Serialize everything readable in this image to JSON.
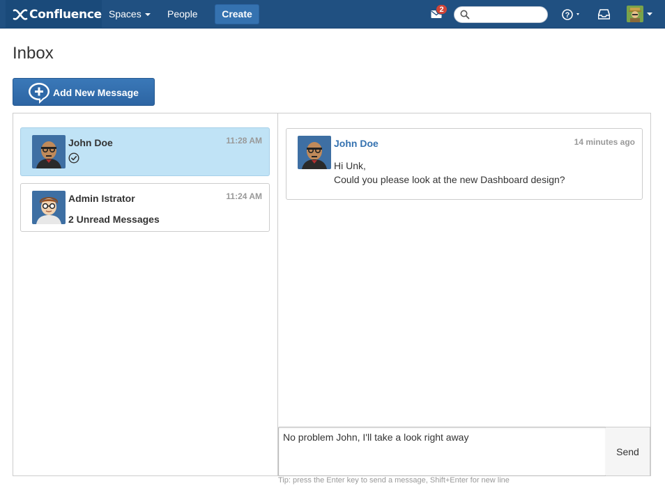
{
  "header": {
    "logo_text": "Confluence",
    "nav": {
      "spaces": "Spaces",
      "people": "People",
      "create": "Create"
    },
    "mail_badge": "2",
    "search_placeholder": ""
  },
  "page": {
    "title": "Inbox",
    "add_button": "Add New Message"
  },
  "conversations": [
    {
      "name": "John Doe",
      "time": "11:28 AM",
      "status": "read",
      "active": true
    },
    {
      "name": "Admin Istrator",
      "time": "11:24 AM",
      "unread": "2 Unread Messages",
      "active": false
    }
  ],
  "thread": {
    "author": "John Doe",
    "time": "14 minutes ago",
    "line1": "Hi Unk,",
    "line2": "Could you please look at the new Dashboard design?"
  },
  "compose": {
    "value": "No problem John, I'll take a look right away",
    "send_label": "Send",
    "tip": "Tip: press the Enter key to send a message, Shift+Enter for new line"
  },
  "colors": {
    "header_bg": "#205081",
    "accent": "#3572b0",
    "active_conv_bg": "#c0e3f6",
    "badge": "#d04437"
  }
}
